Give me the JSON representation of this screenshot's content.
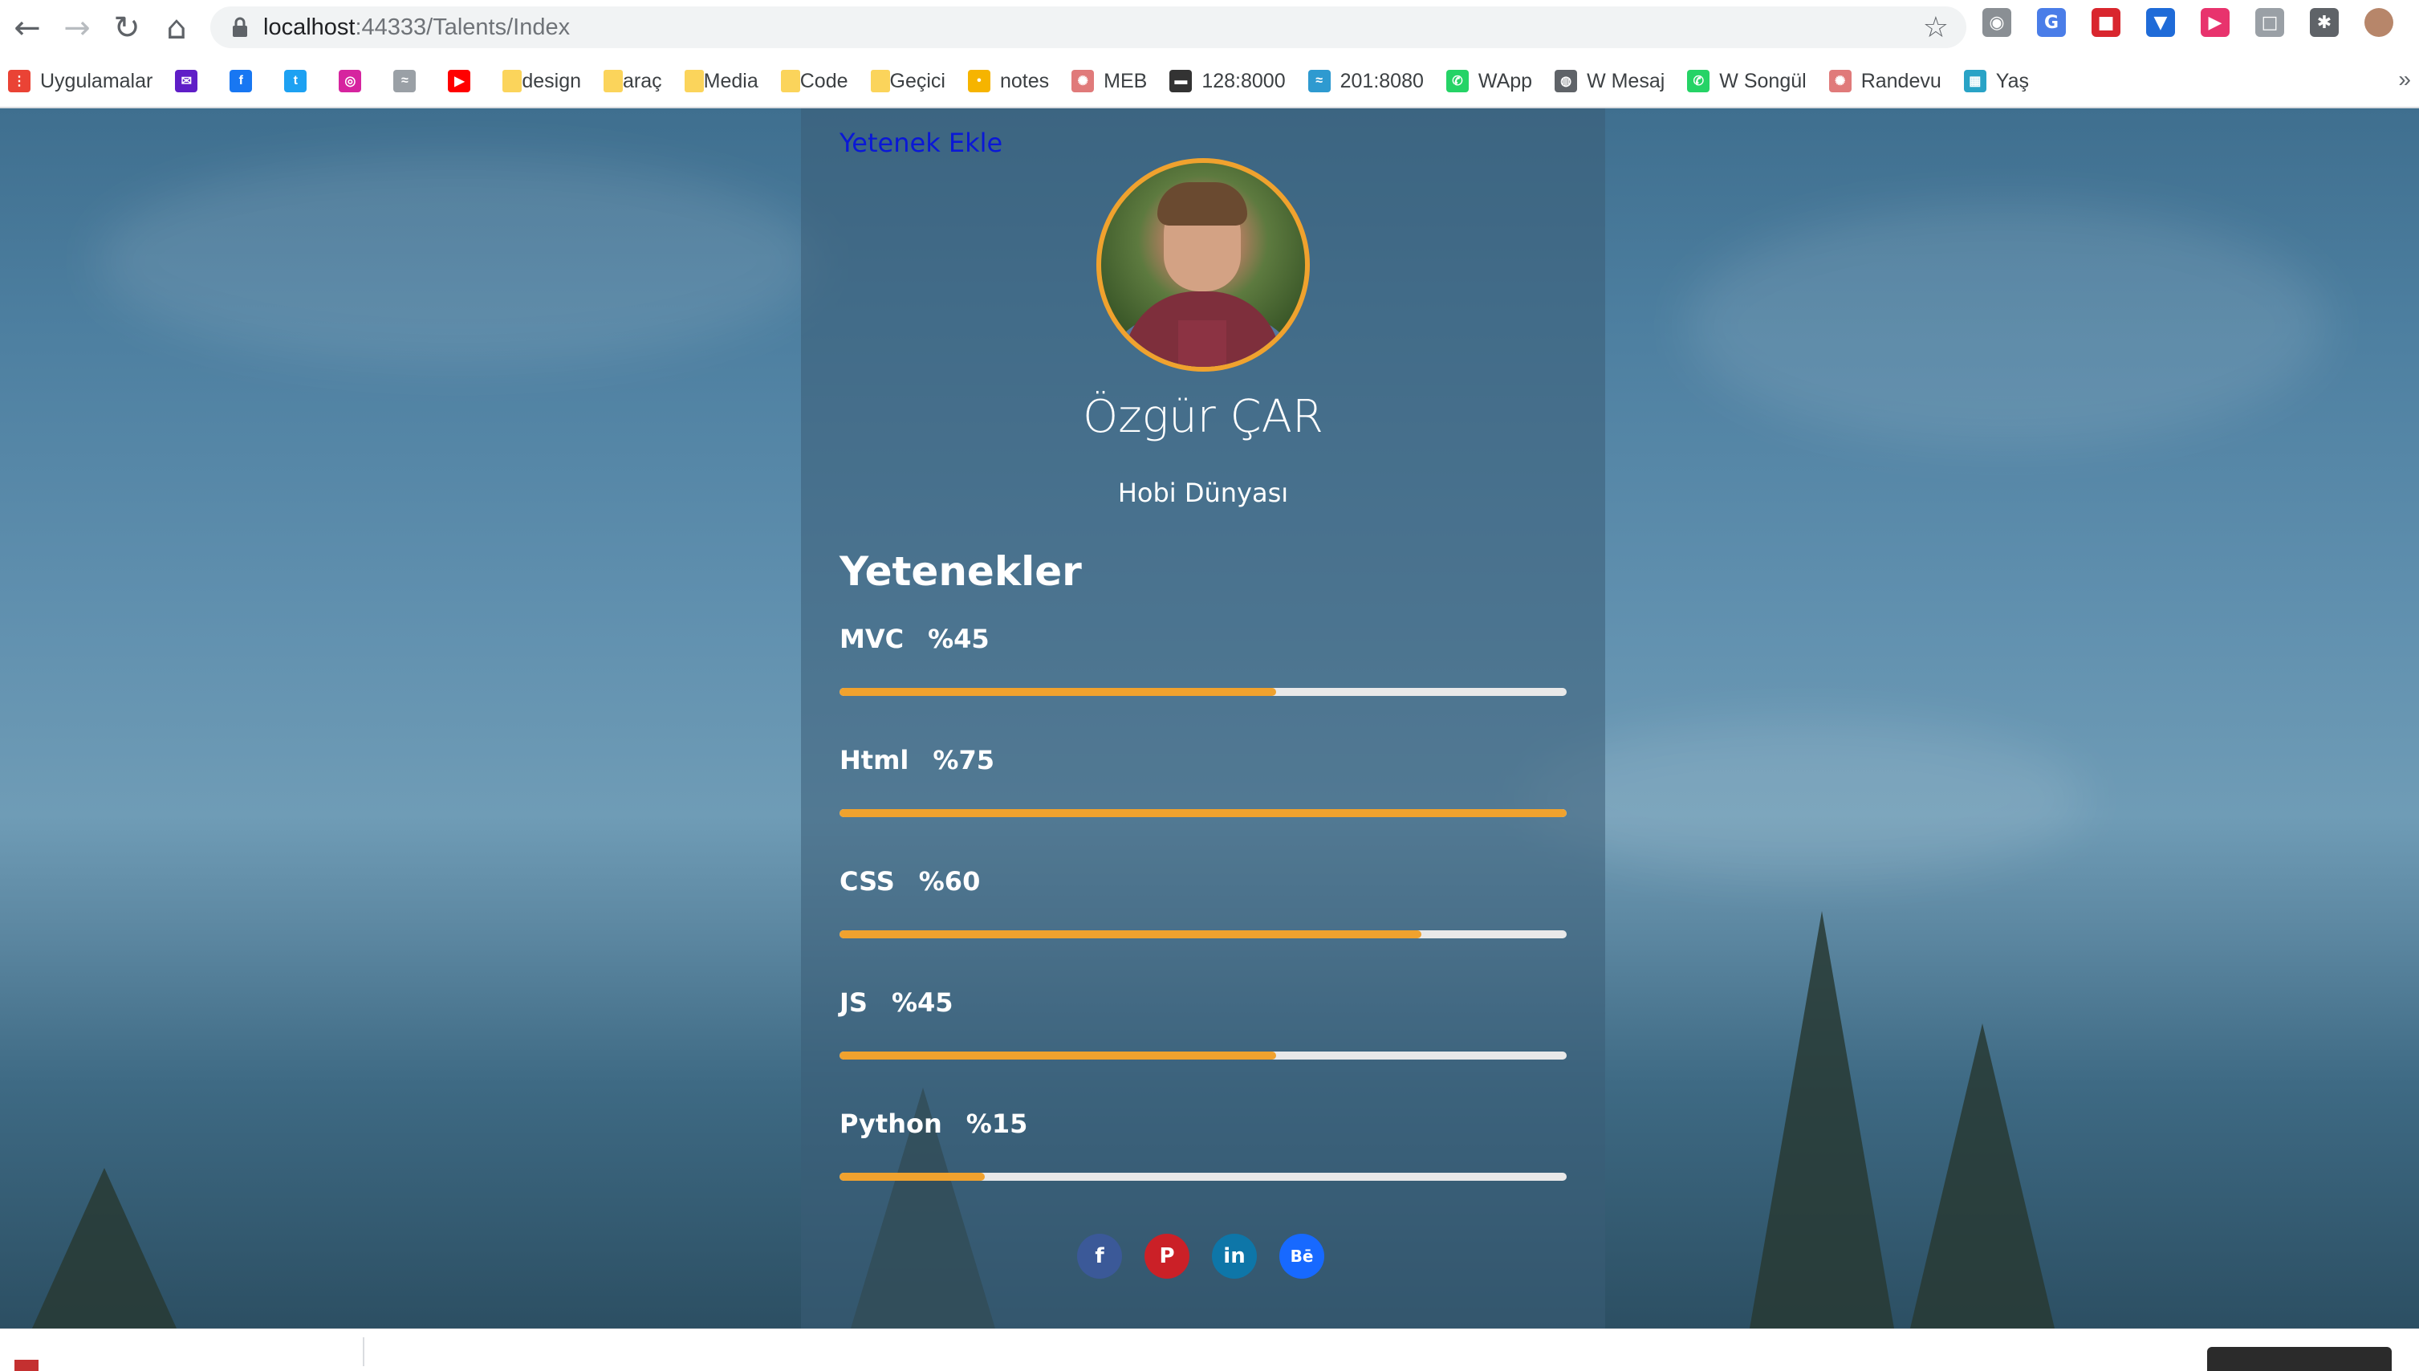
{
  "browser": {
    "url_host": "localhost",
    "url_port_path": ":44333/Talents/Index",
    "bookmarks": [
      {
        "label": "Uygulamalar",
        "icon": "apps-grid-icon"
      },
      {
        "label": "",
        "icon": "mail-icon"
      },
      {
        "label": "",
        "icon": "facebook-icon"
      },
      {
        "label": "",
        "icon": "twitter-icon"
      },
      {
        "label": "",
        "icon": "instagram-icon"
      },
      {
        "label": "",
        "icon": "wireless-icon"
      },
      {
        "label": "",
        "icon": "youtube-icon"
      },
      {
        "label": "design",
        "icon": "folder-icon"
      },
      {
        "label": "araç",
        "icon": "folder-icon"
      },
      {
        "label": "Media",
        "icon": "folder-icon"
      },
      {
        "label": "Code",
        "icon": "folder-icon"
      },
      {
        "label": "Geçici",
        "icon": "folder-icon"
      },
      {
        "label": "notes",
        "icon": "keep-icon"
      },
      {
        "label": "MEB",
        "icon": "meb-icon"
      },
      {
        "label": "128:8000",
        "icon": "device-icon"
      },
      {
        "label": "201:8080",
        "icon": "wifi-icon"
      },
      {
        "label": "WApp",
        "icon": "whatsapp-icon"
      },
      {
        "label": "W Mesaj",
        "icon": "globe-icon"
      },
      {
        "label": "W Songül",
        "icon": "whatsapp-icon"
      },
      {
        "label": "Randevu",
        "icon": "meb-icon"
      },
      {
        "label": "Yaş",
        "icon": "grid-icon"
      }
    ],
    "more": "»"
  },
  "page": {
    "add_link": "Yetenek Ekle",
    "name": "Özgür ÇAR",
    "subtitle": "Hobi Dünyası",
    "skills_title": "Yetenekler",
    "skills": [
      {
        "name": "MVC",
        "percent_label": "%45",
        "bar_fill": 0.6
      },
      {
        "name": "Html",
        "percent_label": "%75",
        "bar_fill": 1.0
      },
      {
        "name": "CSS",
        "percent_label": "%60",
        "bar_fill": 0.8
      },
      {
        "name": "JS",
        "percent_label": "%45",
        "bar_fill": 0.6
      },
      {
        "name": "Python",
        "percent_label": "%15",
        "bar_fill": 0.2
      }
    ],
    "socials": [
      {
        "label": "f",
        "icon": "facebook-icon",
        "color": "#3b5998"
      },
      {
        "label": "P",
        "icon": "pinterest-icon",
        "color": "#cb2027"
      },
      {
        "label": "in",
        "icon": "linkedin-icon",
        "color": "#0e76a8"
      },
      {
        "label": "Bē",
        "icon": "behance-icon",
        "color": "#1769ff"
      }
    ],
    "accent_color": "#f0a22e"
  }
}
